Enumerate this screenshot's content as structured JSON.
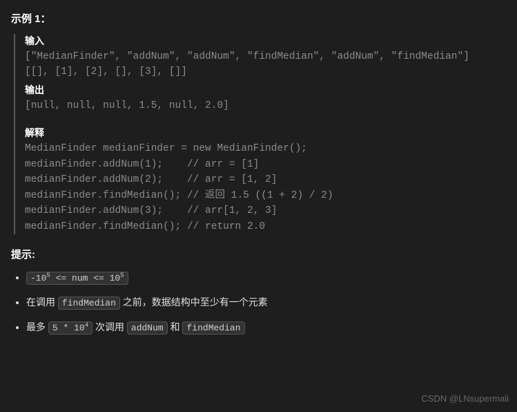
{
  "example": {
    "heading": "示例 1：",
    "input_label": "输入",
    "input_line1": "[\"MedianFinder\", \"addNum\", \"addNum\", \"findMedian\", \"addNum\", \"findMedian\"]",
    "input_line2": "[[], [1], [2], [], [3], []]",
    "output_label": "输出",
    "output_line": "[null, null, null, 1.5, null, 2.0]",
    "explain_label": "解释",
    "explain_lines": [
      "MedianFinder medianFinder = new MedianFinder();",
      "medianFinder.addNum(1);    // arr = [1]",
      "medianFinder.addNum(2);    // arr = [1, 2]",
      "medianFinder.findMedian(); // 返回 1.5 ((1 + 2) / 2)",
      "medianFinder.addNum(3);    // arr[1, 2, 3]",
      "medianFinder.findMedian(); // return 2.0"
    ]
  },
  "hints": {
    "heading": "提示:",
    "item1_code": "-10⁵ <= num <= 10⁵",
    "item2_text_before": "在调用 ",
    "item2_code": "findMedian",
    "item2_text_after": " 之前，数据结构中至少有一个元素",
    "item3_text1": "最多 ",
    "item3_code1": "5 * 10⁴",
    "item3_text2": " 次调用 ",
    "item3_code2": "addNum",
    "item3_text3": " 和 ",
    "item3_code3": "findMedian"
  },
  "watermark": "CSDN @LNsupermali"
}
